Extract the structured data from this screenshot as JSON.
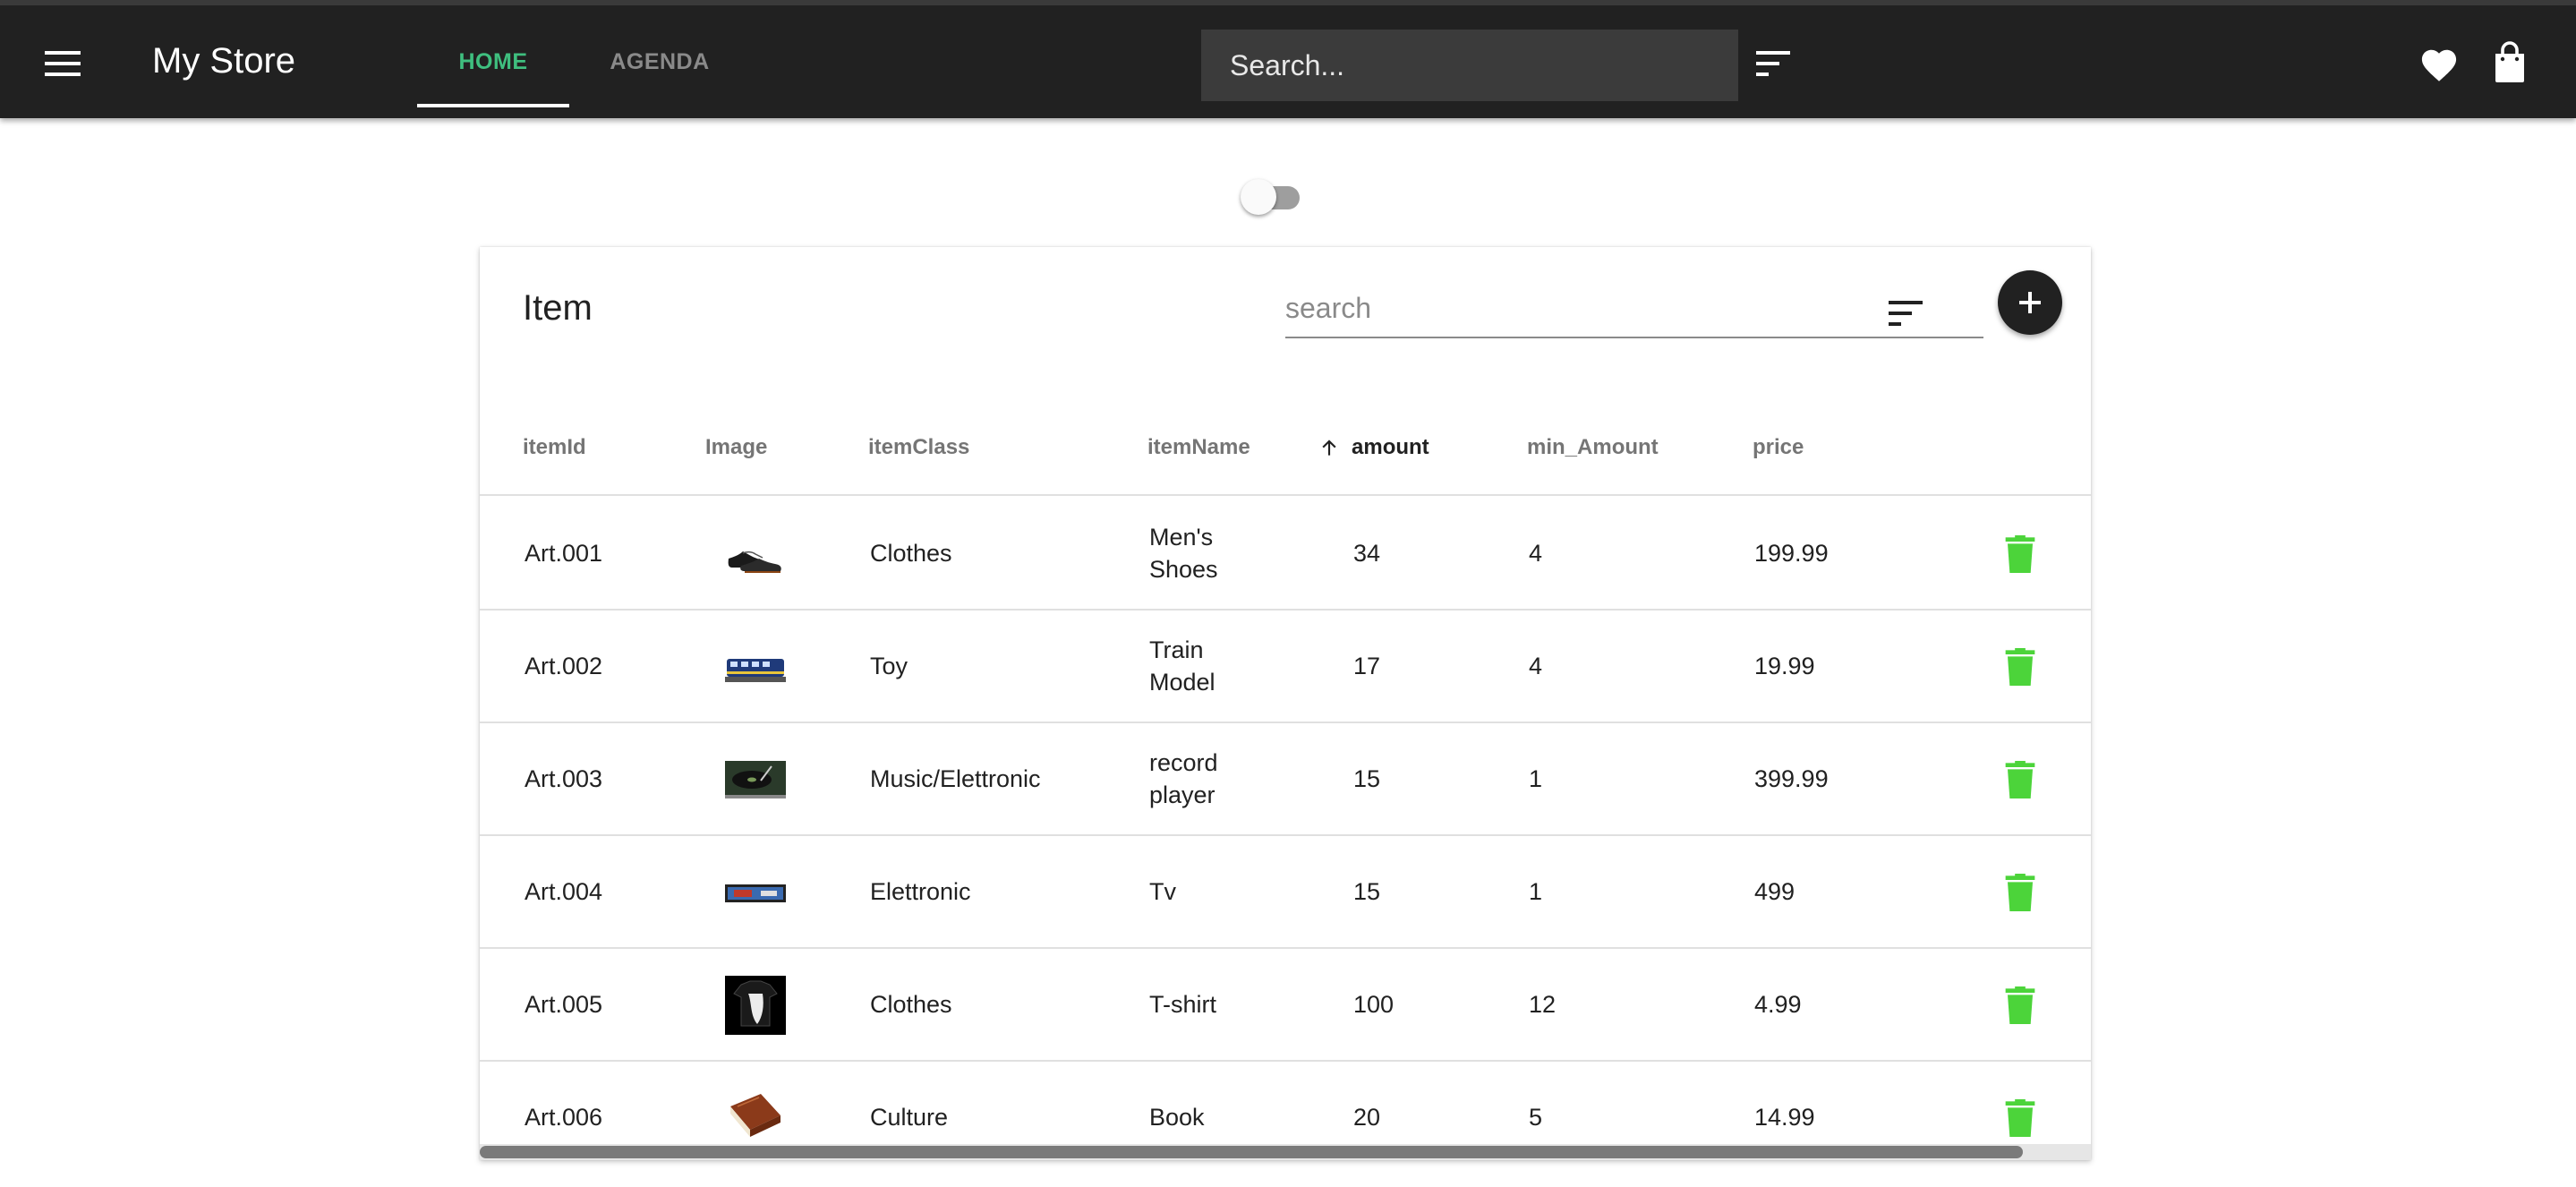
{
  "header": {
    "title": "My Store",
    "tabs": [
      {
        "label": "HOME",
        "active": true
      },
      {
        "label": "AGENDA",
        "active": false
      }
    ],
    "search_placeholder": "Search...",
    "icons": {
      "menu": "menu-icon",
      "filter": "sort-filter-icon",
      "favorites": "heart-icon",
      "cart": "shopping-bag-icon"
    }
  },
  "toggle": {
    "checked": false
  },
  "card": {
    "title": "Item",
    "search_placeholder": "search",
    "add_icon": "plus-icon",
    "filter_icon": "sort-filter-icon"
  },
  "table": {
    "columns": [
      "itemId",
      "Image",
      "itemClass",
      "itemName",
      "amount",
      "min_Amount",
      "price"
    ],
    "sorted_column": "amount",
    "sort_direction": "ascending",
    "rows": [
      {
        "itemId": "Art.001",
        "image": "shoes-thumbnail",
        "itemClass": "Clothes",
        "itemName": "Men's Shoes",
        "amount": "34",
        "min_Amount": "4",
        "price": "199.99"
      },
      {
        "itemId": "Art.002",
        "image": "train-thumbnail",
        "itemClass": "Toy",
        "itemName": "Train Model",
        "amount": "17",
        "min_Amount": "4",
        "price": "19.99"
      },
      {
        "itemId": "Art.003",
        "image": "record-player-thumbnail",
        "itemClass": "Music/Elettronic",
        "itemName": "record player",
        "amount": "15",
        "min_Amount": "1",
        "price": "399.99"
      },
      {
        "itemId": "Art.004",
        "image": "tv-thumbnail",
        "itemClass": "Elettronic",
        "itemName": "Tv",
        "amount": "15",
        "min_Amount": "1",
        "price": "499"
      },
      {
        "itemId": "Art.005",
        "image": "tshirt-thumbnail",
        "itemClass": "Clothes",
        "itemName": "T-shirt",
        "amount": "100",
        "min_Amount": "12",
        "price": "4.99"
      },
      {
        "itemId": "Art.006",
        "image": "book-thumbnail",
        "itemClass": "Culture",
        "itemName": "Book",
        "amount": "20",
        "min_Amount": "5",
        "price": "14.99"
      }
    ],
    "delete_icon": "trash-icon"
  },
  "colors": {
    "toolbar": "#212121",
    "active_tab": "#3fbf7f",
    "inactive_tab": "#8a8a8a",
    "delete": "#4cd43a",
    "fab": "#212121"
  }
}
